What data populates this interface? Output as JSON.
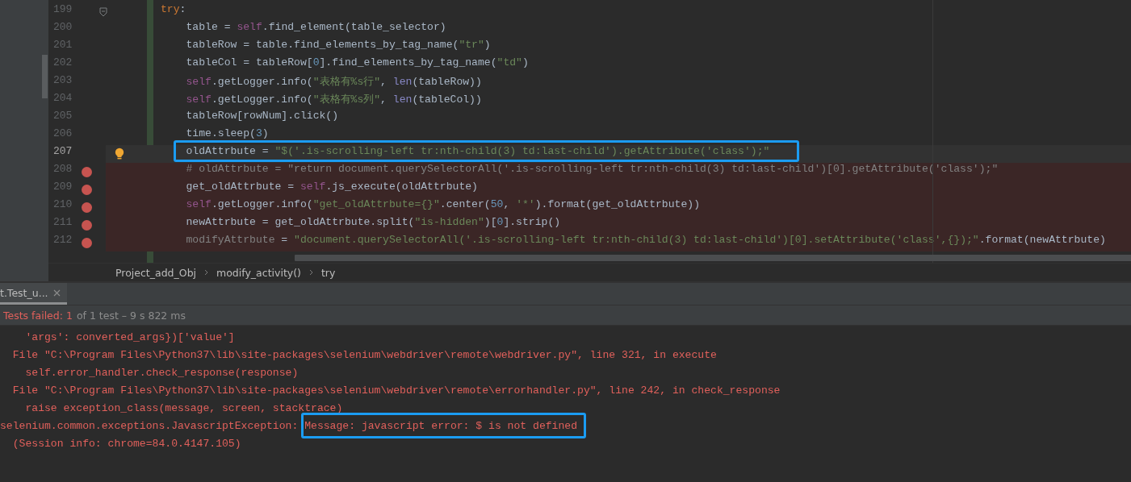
{
  "editor": {
    "lines": [
      {
        "number": "199",
        "tokens": [
          {
            "kind": "keyword",
            "text": "try"
          },
          {
            "kind": "plain",
            "text": ":"
          }
        ],
        "breakpoint": false,
        "current": false,
        "bulb": false,
        "fold": true,
        "annotated": false,
        "children": [
          {
            "number": "200",
            "tokens": [
              {
                "kind": "plain",
                "text": "table = "
              },
              {
                "kind": "self",
                "text": "self"
              },
              {
                "kind": "plain",
                "text": ".find_element(table_selector)"
              }
            ],
            "breakpoint": false,
            "current": false,
            "bulb": false,
            "fold": false,
            "annotated": false
          },
          {
            "number": "201",
            "tokens": [
              {
                "kind": "plain",
                "text": "tableRow = table.find_elements_by_tag_name("
              },
              {
                "kind": "string",
                "text": "\"tr\""
              },
              {
                "kind": "plain",
                "text": ")"
              }
            ],
            "breakpoint": false,
            "current": false,
            "bulb": false,
            "fold": false,
            "annotated": false
          },
          {
            "number": "202",
            "tokens": [
              {
                "kind": "plain",
                "text": "tableCol = tableRow["
              },
              {
                "kind": "number",
                "text": "0"
              },
              {
                "kind": "plain",
                "text": "].find_elements_by_tag_name("
              },
              {
                "kind": "string",
                "text": "\"td\""
              },
              {
                "kind": "plain",
                "text": ")"
              }
            ],
            "breakpoint": false,
            "current": false,
            "bulb": false,
            "fold": false,
            "annotated": false
          },
          {
            "number": "203",
            "tokens": [
              {
                "kind": "self",
                "text": "self"
              },
              {
                "kind": "plain",
                "text": ".getLogger.info("
              },
              {
                "kind": "string",
                "text": "\"表格有%s行\""
              },
              {
                "kind": "plain",
                "text": ", "
              },
              {
                "kind": "builtin",
                "text": "len"
              },
              {
                "kind": "plain",
                "text": "(tableRow))"
              }
            ],
            "breakpoint": false,
            "current": false,
            "bulb": false,
            "fold": false,
            "annotated": false
          },
          {
            "number": "204",
            "tokens": [
              {
                "kind": "self",
                "text": "self"
              },
              {
                "kind": "plain",
                "text": ".getLogger.info("
              },
              {
                "kind": "string",
                "text": "\"表格有%s列\""
              },
              {
                "kind": "plain",
                "text": ", "
              },
              {
                "kind": "builtin",
                "text": "len"
              },
              {
                "kind": "plain",
                "text": "(tableCol))"
              }
            ],
            "breakpoint": false,
            "current": false,
            "bulb": false,
            "fold": false,
            "annotated": false
          },
          {
            "number": "205",
            "tokens": [
              {
                "kind": "plain",
                "text": "tableRow[rowNum].click()"
              }
            ],
            "breakpoint": false,
            "current": false,
            "bulb": false,
            "fold": false,
            "annotated": false
          },
          {
            "number": "206",
            "tokens": [
              {
                "kind": "plain",
                "text": "time.sleep("
              },
              {
                "kind": "number",
                "text": "3"
              },
              {
                "kind": "plain",
                "text": ")"
              }
            ],
            "breakpoint": false,
            "current": false,
            "bulb": false,
            "fold": false,
            "annotated": false
          },
          {
            "number": "207",
            "tokens": [
              {
                "kind": "plain",
                "text": "oldAttrbute = "
              },
              {
                "kind": "string",
                "text": "\"$('.is-scrolling-left tr:nth-child(3) td:last-child').getAttribute('class');\""
              }
            ],
            "breakpoint": false,
            "current": true,
            "bulb": true,
            "fold": false,
            "annotated": true
          },
          {
            "number": "208",
            "tokens": [
              {
                "kind": "comment",
                "text": "# oldAttrbute = \"return document.querySelectorAll('.is-scrolling-left tr:nth-child(3) td:last-child')[0].getAttribute('class');\""
              }
            ],
            "breakpoint": true,
            "current": false,
            "bulb": false,
            "fold": false,
            "annotated": false
          },
          {
            "number": "209",
            "tokens": [
              {
                "kind": "plain",
                "text": "get_oldAttrbute = "
              },
              {
                "kind": "self",
                "text": "self"
              },
              {
                "kind": "plain",
                "text": ".js_execute(oldAttrbute)"
              }
            ],
            "breakpoint": true,
            "current": false,
            "bulb": false,
            "fold": false,
            "annotated": false
          },
          {
            "number": "210",
            "tokens": [
              {
                "kind": "self",
                "text": "self"
              },
              {
                "kind": "plain",
                "text": ".getLogger.info("
              },
              {
                "kind": "string",
                "text": "\"get_oldAttrbute={}\""
              },
              {
                "kind": "plain",
                "text": ".center("
              },
              {
                "kind": "number",
                "text": "50"
              },
              {
                "kind": "plain",
                "text": ", "
              },
              {
                "kind": "string",
                "text": "'*'"
              },
              {
                "kind": "plain",
                "text": ").format(get_oldAttrbute))"
              }
            ],
            "breakpoint": true,
            "current": false,
            "bulb": false,
            "fold": false,
            "annotated": false
          },
          {
            "number": "211",
            "tokens": [
              {
                "kind": "plain",
                "text": "newAttrbute = get_oldAttrbute.split("
              },
              {
                "kind": "string",
                "text": "\"is-hidden\""
              },
              {
                "kind": "plain",
                "text": ")["
              },
              {
                "kind": "number",
                "text": "0"
              },
              {
                "kind": "plain",
                "text": "].strip()"
              }
            ],
            "breakpoint": true,
            "current": false,
            "bulb": false,
            "fold": false,
            "annotated": false
          },
          {
            "number": "212",
            "tokens": [
              {
                "kind": "unused",
                "text": "modifyAttrbute"
              },
              {
                "kind": "plain",
                "text": " = "
              },
              {
                "kind": "string",
                "text": "\"document.querySelectorAll('.is-scrolling-left tr:nth-child(3) td:last-child')[0].setAttribute('class',{});\""
              },
              {
                "kind": "plain",
                "text": ".format(newAttrbute)"
              }
            ],
            "breakpoint": true,
            "current": false,
            "bulb": false,
            "fold": false,
            "annotated": false
          }
        ]
      }
    ]
  },
  "breadcrumbs": [
    "Project_add_Obj",
    "modify_activity()",
    "try"
  ],
  "run_panel": {
    "tabs": [
      {
        "label": "t.Test_u...",
        "selected": true
      }
    ],
    "status": {
      "failed": "Tests failed: 1",
      "summary": "of 1 test – 9 s 822 ms"
    },
    "console": [
      {
        "segments": [
          {
            "text": "    'args': converted_args})['value']",
            "annotated": false
          }
        ]
      },
      {
        "segments": [
          {
            "text": "  File \"C:\\Program Files\\Python37\\lib\\site-packages\\selenium\\webdriver\\remote\\webdriver.py\", line 321, in execute",
            "annotated": false
          }
        ]
      },
      {
        "segments": [
          {
            "text": "    self.error_handler.check_response(response)",
            "annotated": false
          }
        ]
      },
      {
        "segments": [
          {
            "text": "  File \"C:\\Program Files\\Python37\\lib\\site-packages\\selenium\\webdriver\\remote\\errorhandler.py\", line 242, in check_response",
            "annotated": false
          }
        ]
      },
      {
        "segments": [
          {
            "text": "    raise exception_class(message, screen, stacktrace)",
            "annotated": false
          }
        ]
      },
      {
        "segments": [
          {
            "text": "selenium.common.exceptions.JavascriptException: ",
            "annotated": false
          },
          {
            "text": "Message: javascript error: $ is not defined",
            "annotated": true
          }
        ]
      },
      {
        "segments": [
          {
            "text": "  (Session info: chrome=84.0.4147.105)",
            "annotated": false
          }
        ]
      }
    ]
  }
}
